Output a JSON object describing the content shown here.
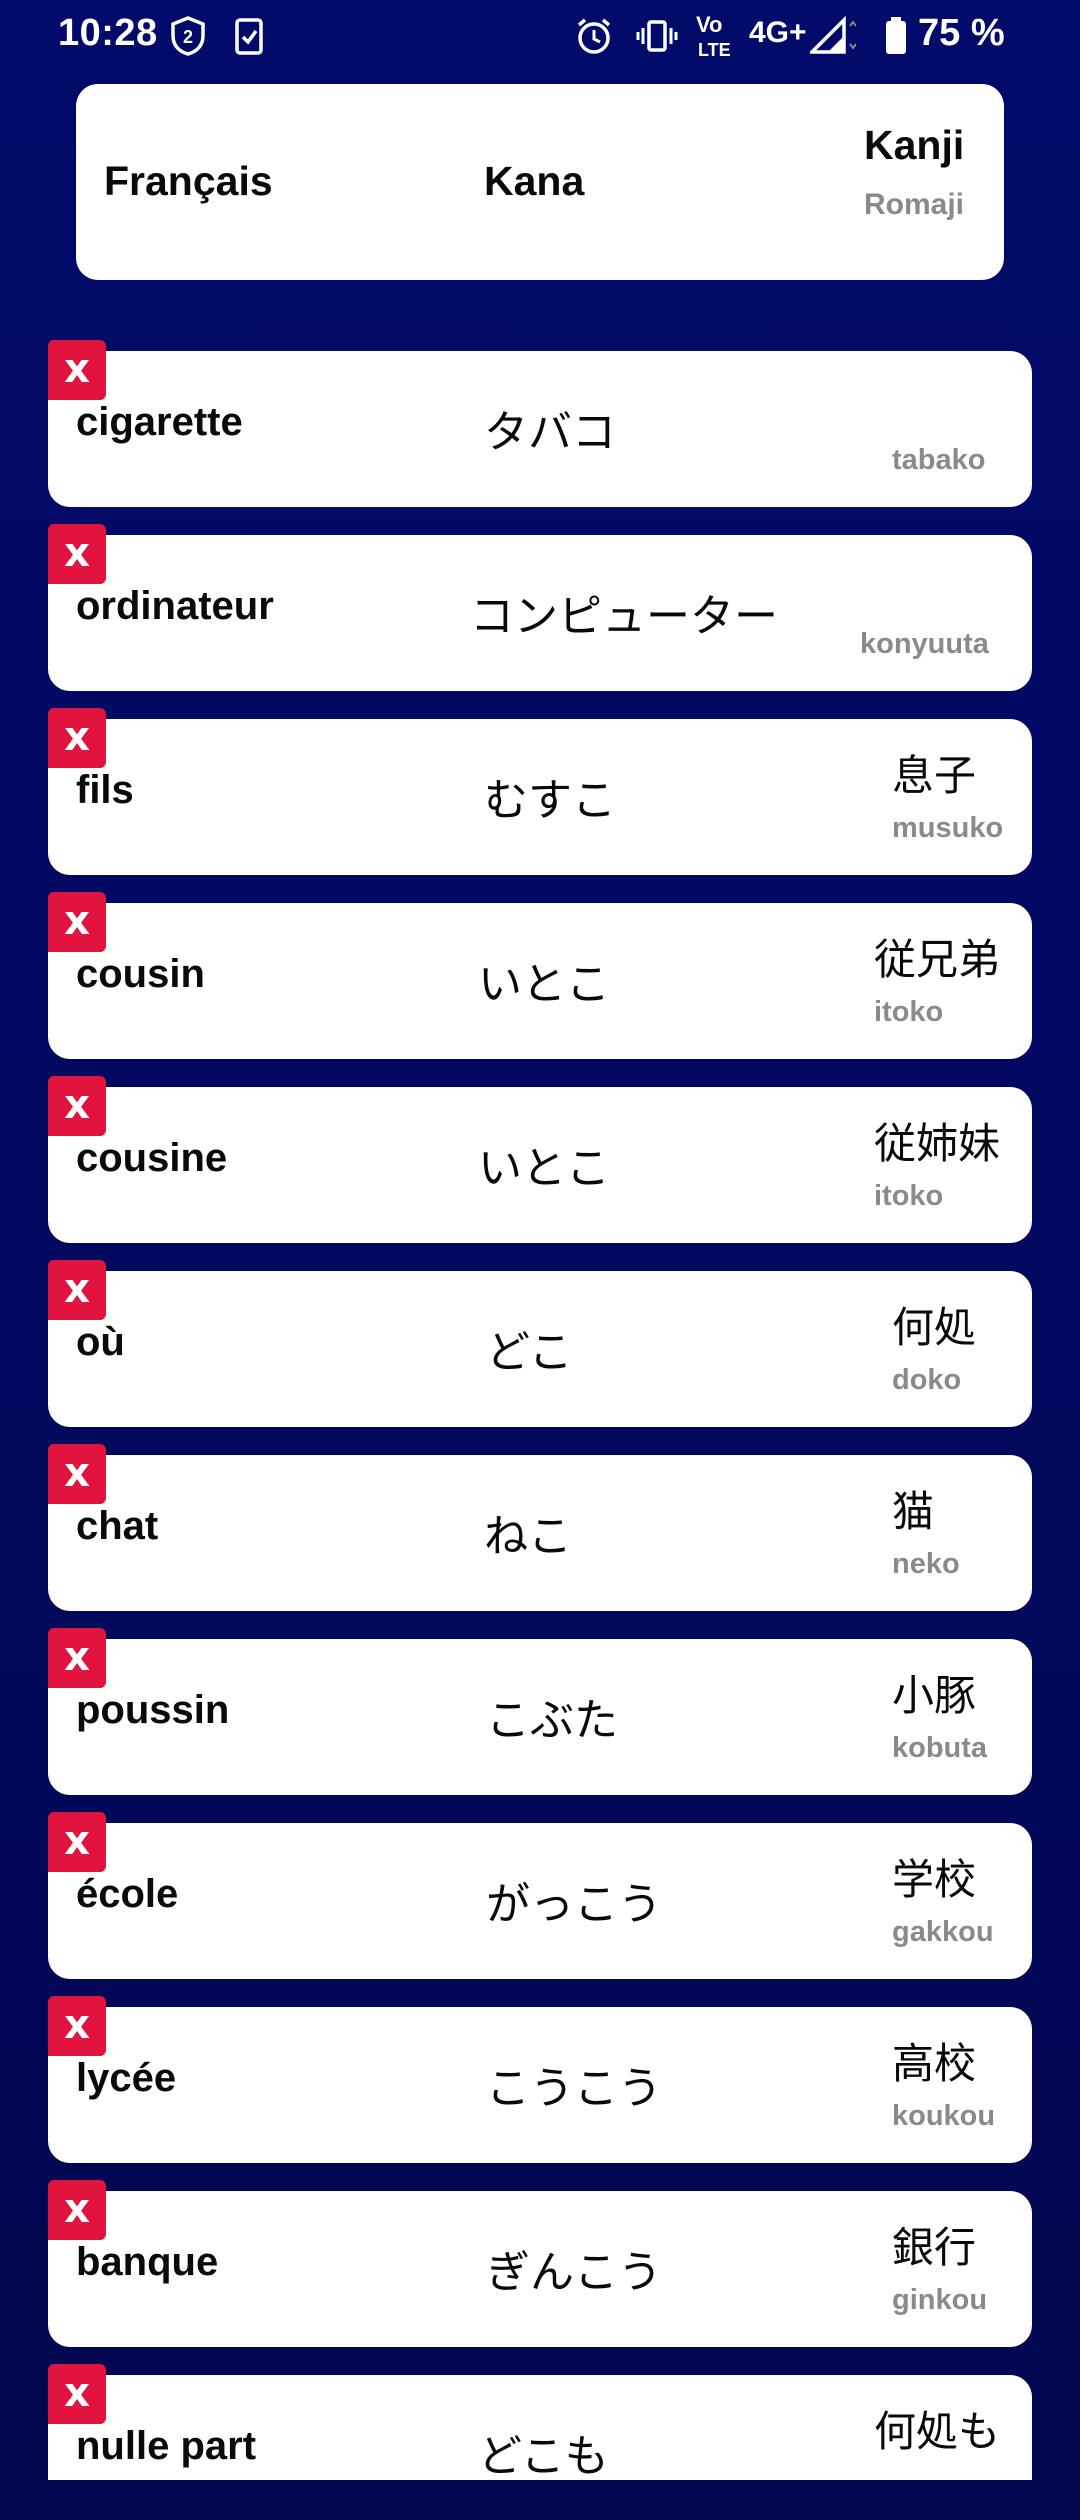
{
  "status_bar": {
    "time": "10:28",
    "network": "4G+",
    "battery": "75 %",
    "icons": [
      "badge-2-icon",
      "clipboard-check-icon",
      "alarm-icon",
      "vibrate-icon",
      "volte-icon",
      "signal-icon",
      "battery-icon"
    ]
  },
  "header": {
    "francais": "Français",
    "kana": "Kana",
    "kanji": "Kanji",
    "romaji": "Romaji"
  },
  "delete_label": "x",
  "words": [
    {
      "fr": "cigarette",
      "kana": "タバコ",
      "kanji": "",
      "romaji": "tabako"
    },
    {
      "fr": "ordinateur",
      "kana": "コンピューター",
      "kanji": "",
      "romaji": "konyuuta"
    },
    {
      "fr": "fils",
      "kana": "むすこ",
      "kanji": "息子",
      "romaji": "musuko"
    },
    {
      "fr": "cousin",
      "kana": "いとこ",
      "kanji": "従兄弟",
      "romaji": "itoko"
    },
    {
      "fr": "cousine",
      "kana": "いとこ",
      "kanji": "従姉妹",
      "romaji": "itoko"
    },
    {
      "fr": "où",
      "kana": "どこ",
      "kanji": "何処",
      "romaji": "doko"
    },
    {
      "fr": "chat",
      "kana": "ねこ",
      "kanji": "猫",
      "romaji": "neko"
    },
    {
      "fr": "poussin",
      "kana": "こぶた",
      "kanji": "小豚",
      "romaji": "kobuta"
    },
    {
      "fr": "école",
      "kana": "がっこう",
      "kanji": "学校",
      "romaji": "gakkou"
    },
    {
      "fr": "lycée",
      "kana": "こうこう",
      "kanji": "高校",
      "romaji": "koukou"
    },
    {
      "fr": "banque",
      "kana": "ぎんこう",
      "kanji": "銀行",
      "romaji": "ginkou"
    },
    {
      "fr": "nulle part",
      "kana": "どこも",
      "kanji": "何処も",
      "romaji": ""
    }
  ]
}
